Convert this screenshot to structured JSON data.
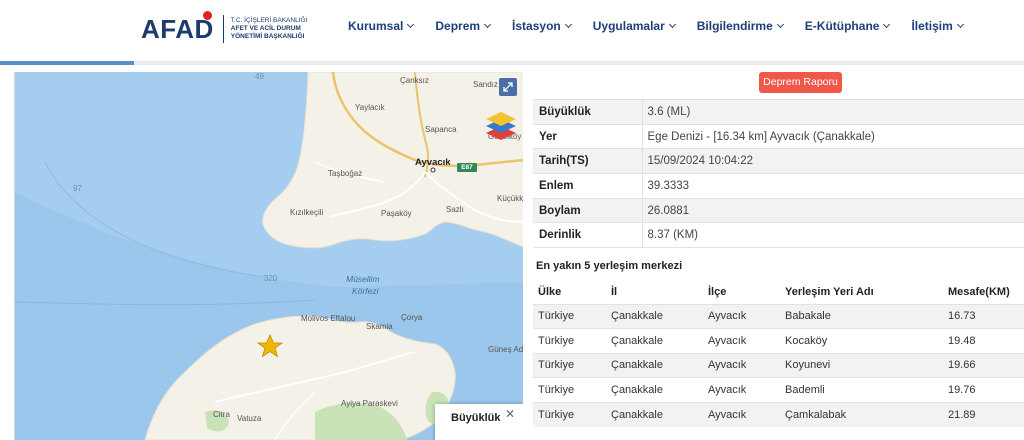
{
  "header": {
    "logo_text": "AFAD",
    "logo_sub": [
      "T.C. İÇİŞLERİ BAKANLIĞI",
      "AFET VE ACİL DURUM",
      "YÖNETİMİ BAŞKANLIĞI"
    ],
    "nav": [
      "Kurumsal",
      "Deprem",
      "İstasyon",
      "Uygulamalar",
      "Bilgilendirme",
      "E-Kütüphane",
      "İletişim"
    ]
  },
  "map": {
    "labels": {
      "d49": "49",
      "d97": "97",
      "d320": "320",
      "canakkale_x": "Çanksız",
      "sandiz": "Sandız",
      "yaylacik": "Yaylacık",
      "sapanca": "Sapanca",
      "guzelkoy": "Güzelköy",
      "ayvacik": "Ayvacık",
      "tasbogaz": "Taşboğaz",
      "kucukk": "Küçükk",
      "kizilkecili": "Kızılkeçili",
      "pasakoy": "Paşaköy",
      "sazli": "Sazlı",
      "musellim": "Müsellim",
      "korfezi": "Körfezi",
      "molivos": "Molivos Eftalou",
      "skamia": "Skamia",
      "corya": "Çorya",
      "gunes": "Güneş Ad.",
      "ayiya": "Ayiya Paraskevi",
      "citra": "Citra",
      "vatuza": "Vatuza",
      "road": "E87"
    },
    "legend_title": "Büyüklük",
    "legend_close": "✕"
  },
  "report_button": "Deprem Raporu",
  "details": [
    {
      "key": "Büyüklük",
      "value": "3.6 (ML)"
    },
    {
      "key": "Yer",
      "value": "Ege Denizi - [16.34 km] Ayvacık (Çanakkale)"
    },
    {
      "key": "Tarih(TS)",
      "value": "15/09/2024 10:04:22"
    },
    {
      "key": "Enlem",
      "value": "39.3333"
    },
    {
      "key": "Boylam",
      "value": "26.0881"
    },
    {
      "key": "Derinlik",
      "value": "8.37 (KM)"
    }
  ],
  "nearest": {
    "title": "En yakın 5 yerleşim merkezi",
    "headers": [
      "Ülke",
      "İl",
      "İlçe",
      "Yerleşim Yeri Adı",
      "Mesafe(KM)"
    ],
    "rows": [
      [
        "Türkiye",
        "Çanakkale",
        "Ayvacık",
        "Babakale",
        "16.73"
      ],
      [
        "Türkiye",
        "Çanakkale",
        "Ayvacık",
        "Kocaköy",
        "19.48"
      ],
      [
        "Türkiye",
        "Çanakkale",
        "Ayvacık",
        "Koyunevi",
        "19.66"
      ],
      [
        "Türkiye",
        "Çanakkale",
        "Ayvacık",
        "Bademli",
        "19.76"
      ],
      [
        "Türkiye",
        "Çanakkale",
        "Ayvacık",
        "Çamkalabak",
        "21.89"
      ]
    ]
  }
}
